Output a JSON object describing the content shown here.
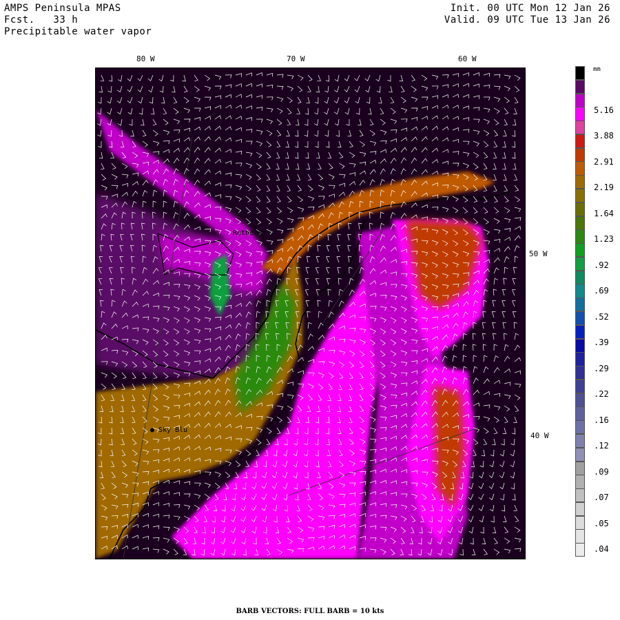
{
  "header": {
    "model": "AMPS Peninsula MPAS",
    "forecast": "Fcst.   33 h",
    "field": "Precipitable water vapor",
    "init": "Init. 00 UTC Mon 12 Jan 26",
    "valid": "Valid. 09 UTC Tue 13 Jan 26"
  },
  "axes": {
    "lon_labels": [
      "80 W",
      "70 W",
      "60 W"
    ],
    "lat_labels": [
      "50 W",
      "40 W"
    ]
  },
  "stations": [
    {
      "name": "Rothera"
    },
    {
      "name": "Sky Blu"
    }
  ],
  "legend": {
    "unit": "mm",
    "tick_labels": [
      "5.16",
      "3.88",
      "2.91",
      "2.19",
      "1.64",
      "1.23",
      ".92",
      ".69",
      ".52",
      ".39",
      ".29",
      ".22",
      ".16",
      ".12",
      ".09",
      ".07",
      ".05",
      ".04"
    ],
    "colors": [
      "#000000",
      "#5a0a66",
      "#c000c8",
      "#ff00ff",
      "#e040a0",
      "#d01a10",
      "#c03a00",
      "#c05a00",
      "#a06a00",
      "#8a7000",
      "#6a7000",
      "#4a7800",
      "#2a8a10",
      "#10a020",
      "#10a040",
      "#108a60",
      "#108a8a",
      "#1070a0",
      "#1050b0",
      "#0020c0",
      "#0a0aa8",
      "#2020a0",
      "#303098",
      "#404098",
      "#505098",
      "#6060a0",
      "#7070a8",
      "#8080b0",
      "#9090b8",
      "#a0a0a0",
      "#b0b0b0",
      "#c0c0c0",
      "#d0d0d0",
      "#dcdcdc",
      "#e4e4e4",
      "#ececec"
    ]
  },
  "footer": "BARB VECTORS:  FULL BARB = 10 kts"
}
